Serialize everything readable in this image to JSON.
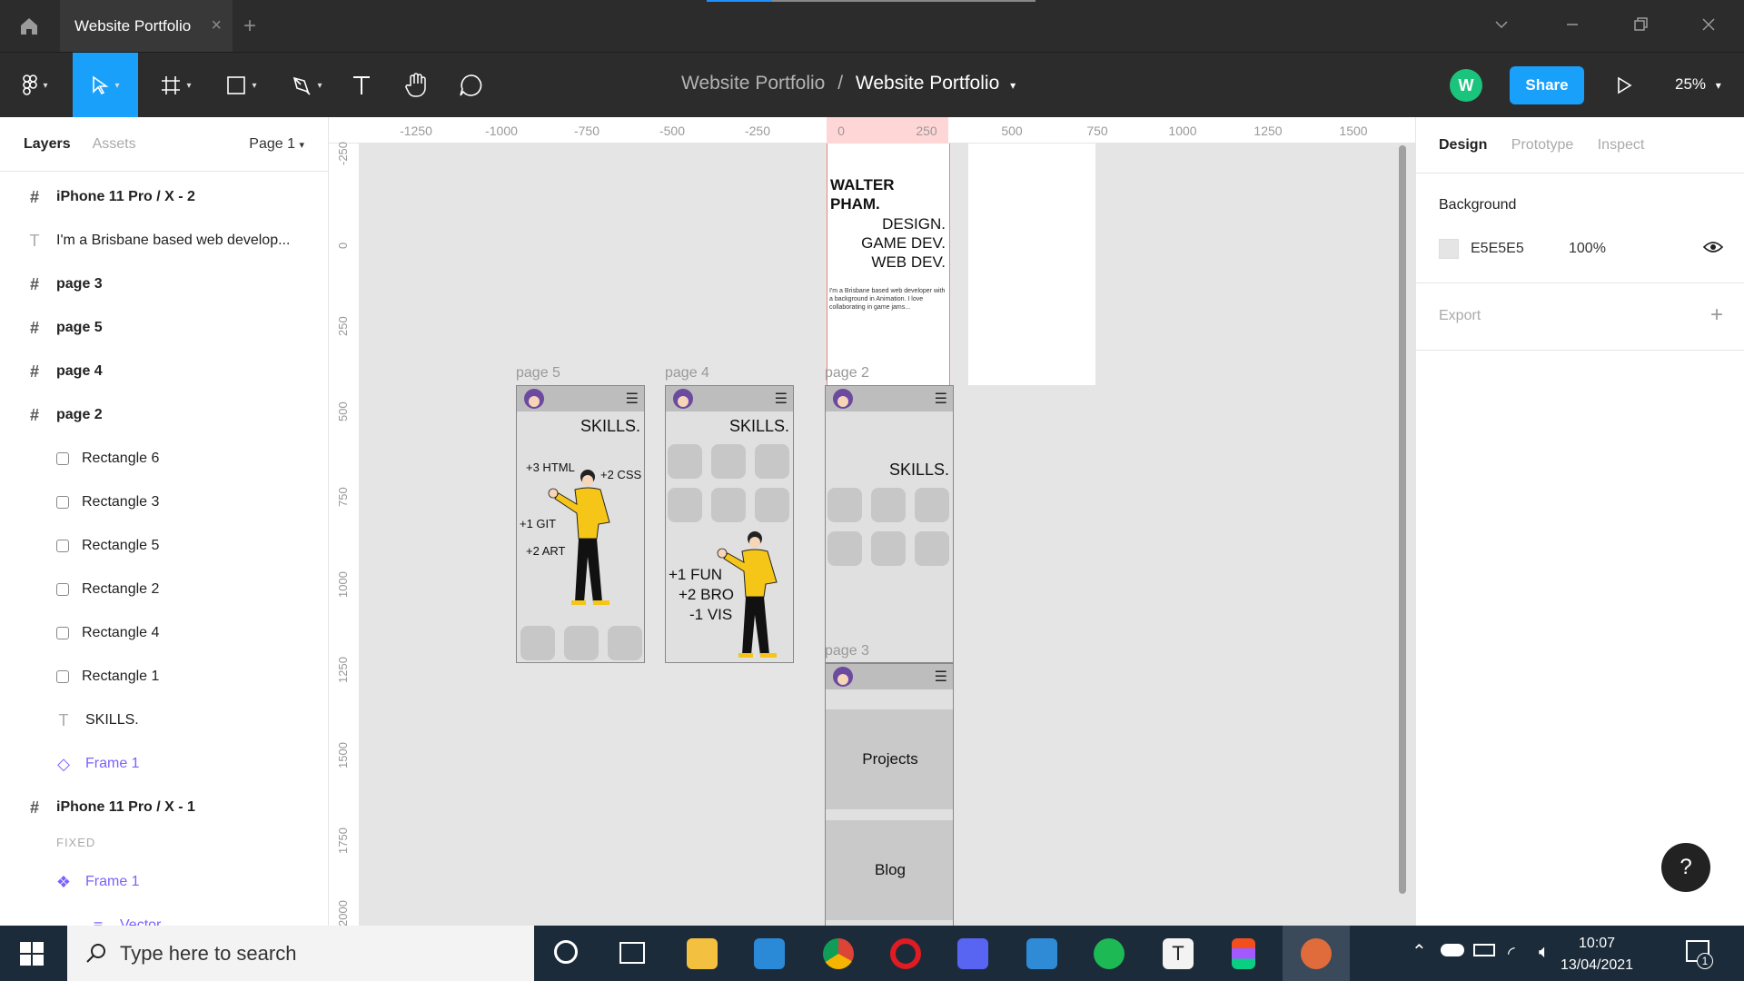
{
  "window": {
    "tab_title": "Website Portfolio",
    "tab_close": "×",
    "tab_add": "+"
  },
  "toolbar": {
    "breadcrumb_project": "Website Portfolio",
    "breadcrumb_sep": "/",
    "breadcrumb_file": "Website Portfolio",
    "user_initial": "W",
    "share_label": "Share",
    "zoom": "25%"
  },
  "left_panel": {
    "tab_layers": "Layers",
    "tab_assets": "Assets",
    "page_select": "Page 1",
    "layers": [
      {
        "label": "iPhone 11 Pro / X - 2",
        "icon": "frame-icon"
      },
      {
        "label": "I'm a Brisbane based web develop...",
        "icon": "text-icon"
      },
      {
        "label": "page 3",
        "icon": "frame-icon"
      },
      {
        "label": "page 5",
        "icon": "frame-icon"
      },
      {
        "label": "page 4",
        "icon": "frame-icon"
      },
      {
        "label": "page 2",
        "icon": "frame-icon"
      },
      {
        "label": "Rectangle 6",
        "icon": "rectangle-icon"
      },
      {
        "label": "Rectangle 3",
        "icon": "rectangle-icon"
      },
      {
        "label": "Rectangle 5",
        "icon": "rectangle-icon"
      },
      {
        "label": "Rectangle 2",
        "icon": "rectangle-icon"
      },
      {
        "label": "Rectangle 4",
        "icon": "rectangle-icon"
      },
      {
        "label": "Rectangle 1",
        "icon": "rectangle-icon"
      },
      {
        "label": "SKILLS.",
        "icon": "text-icon"
      },
      {
        "label": "Frame 1",
        "icon": "component-instance-icon"
      },
      {
        "label": "iPhone 11 Pro / X - 1",
        "icon": "frame-icon"
      },
      {
        "label": "FIXED",
        "icon": ""
      },
      {
        "label": "Frame 1",
        "icon": "component-icon"
      },
      {
        "label": "Vector",
        "icon": "vector-icon"
      }
    ]
  },
  "rulers": {
    "top": [
      "-1250",
      "-1000",
      "-750",
      "-500",
      "-250",
      "0",
      "250",
      "500",
      "750",
      "1000",
      "1250",
      "1500"
    ],
    "left": [
      "-250",
      "0",
      "250",
      "500",
      "750",
      "1000",
      "1250",
      "1500",
      "1750",
      "2000"
    ]
  },
  "canvas": {
    "frames": {
      "page5": "page 5",
      "page4": "page 4",
      "page2": "page 2",
      "page3": "page 3"
    },
    "hero": {
      "name_line1": "WALTER",
      "name_line2": "PHAM.",
      "role1": "DESIGN.",
      "role2": "GAME DEV.",
      "role3": "WEB DEV.",
      "bio": "I'm a Brisbane based web developer with a background in Animation. I love collaborating in game jams..."
    },
    "skills_title": "SKILLS.",
    "page5_skills": [
      "+3 HTML",
      "+2 CSS",
      "+1 GIT",
      "+2 ART"
    ],
    "page4_skills": [
      "+1 FUN",
      "+2 BRO",
      "-1 VIS"
    ],
    "page3_buttons": [
      "Projects",
      "Blog"
    ]
  },
  "right_panel": {
    "tabs": [
      "Design",
      "Prototype",
      "Inspect"
    ],
    "background_label": "Background",
    "bg_hex": "E5E5E5",
    "bg_opacity": "100%",
    "export_label": "Export",
    "export_add": "+",
    "help": "?"
  },
  "taskbar": {
    "search_placeholder": "Type here to search",
    "time": "10:07",
    "date": "13/04/2021",
    "notif_count": "1"
  },
  "colors": {
    "accent": "#18a0fb",
    "avatar": "#1bc47d",
    "canvas_bg": "#E5E5E5",
    "toolbar_bg": "#2c2c2c",
    "component_purple": "#7b61ff"
  }
}
